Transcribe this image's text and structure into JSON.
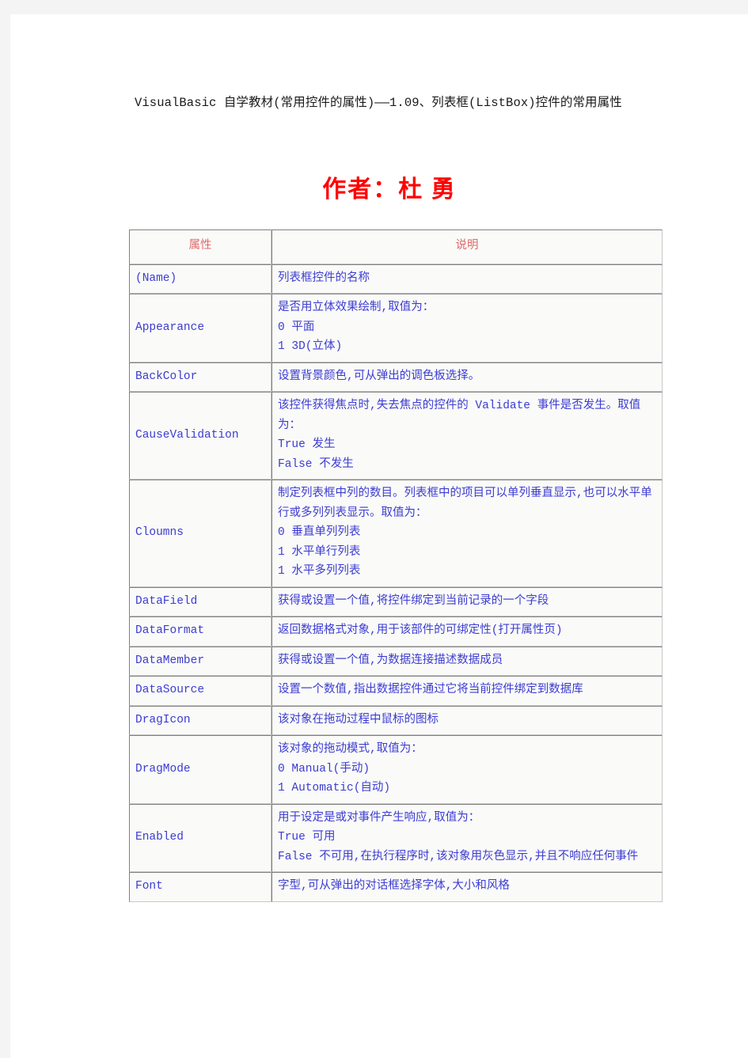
{
  "document": {
    "title": "VisualBasic 自学教材(常用控件的属性)——1.09、列表框(ListBox)控件的常用属性",
    "author_line": "作者：杜 勇"
  },
  "colors": {
    "page_background": "#ffffff",
    "outer_background": "#f4f4f4",
    "author_text": "#ff0000",
    "table_header_text": "#e06a6a",
    "table_body_text": "#3c3cd2",
    "table_border_dark": "#808080",
    "table_border_light": "#c8c8c8",
    "cell_background": "#fafaf9"
  },
  "table": {
    "headers": [
      "属性",
      "说明"
    ],
    "rows": [
      {
        "name": "(Name)",
        "desc": [
          "列表框控件的名称"
        ]
      },
      {
        "name": "Appearance",
        "desc": [
          "是否用立体效果绘制,取值为：",
          "0 平面",
          "1 3D(立体)"
        ]
      },
      {
        "name": "BackColor",
        "desc": [
          "设置背景颜色,可从弹出的调色板选择。"
        ]
      },
      {
        "name": "CauseValidation",
        "desc": [
          "该控件获得焦点时,失去焦点的控件的 Validate 事件是否发生。取值为：",
          "True 发生",
          "False 不发生"
        ]
      },
      {
        "name": "Cloumns",
        "desc": [
          "制定列表框中列的数目。列表框中的项目可以单列垂直显示,也可以水平单行或多列列表显示。取值为：",
          "0 垂直单列列表",
          "1 水平单行列表",
          "1 水平多列列表"
        ]
      },
      {
        "name": "DataField",
        "desc": [
          "获得或设置一个值,将控件绑定到当前记录的一个字段"
        ]
      },
      {
        "name": "DataFormat",
        "desc": [
          "返回数据格式对象,用于该部件的可绑定性(打开属性页)"
        ]
      },
      {
        "name": "DataMember",
        "desc": [
          "获得或设置一个值,为数据连接描述数据成员"
        ]
      },
      {
        "name": "DataSource",
        "desc": [
          "设置一个数值,指出数据控件通过它将当前控件绑定到数据库"
        ]
      },
      {
        "name": "DragIcon",
        "desc": [
          "该对象在拖动过程中鼠标的图标"
        ]
      },
      {
        "name": "DragMode",
        "desc": [
          "该对象的拖动模式,取值为：",
          "0 Manual(手动)",
          "1 Automatic(自动)"
        ]
      },
      {
        "name": "Enabled",
        "desc": [
          "用于设定是或对事件产生响应,取值为：",
          "True 可用",
          "False 不可用,在执行程序时,该对象用灰色显示,并且不响应任何事件"
        ]
      },
      {
        "name": "Font",
        "desc": [
          "字型,可从弹出的对话框选择字体,大小和风格"
        ]
      }
    ]
  }
}
